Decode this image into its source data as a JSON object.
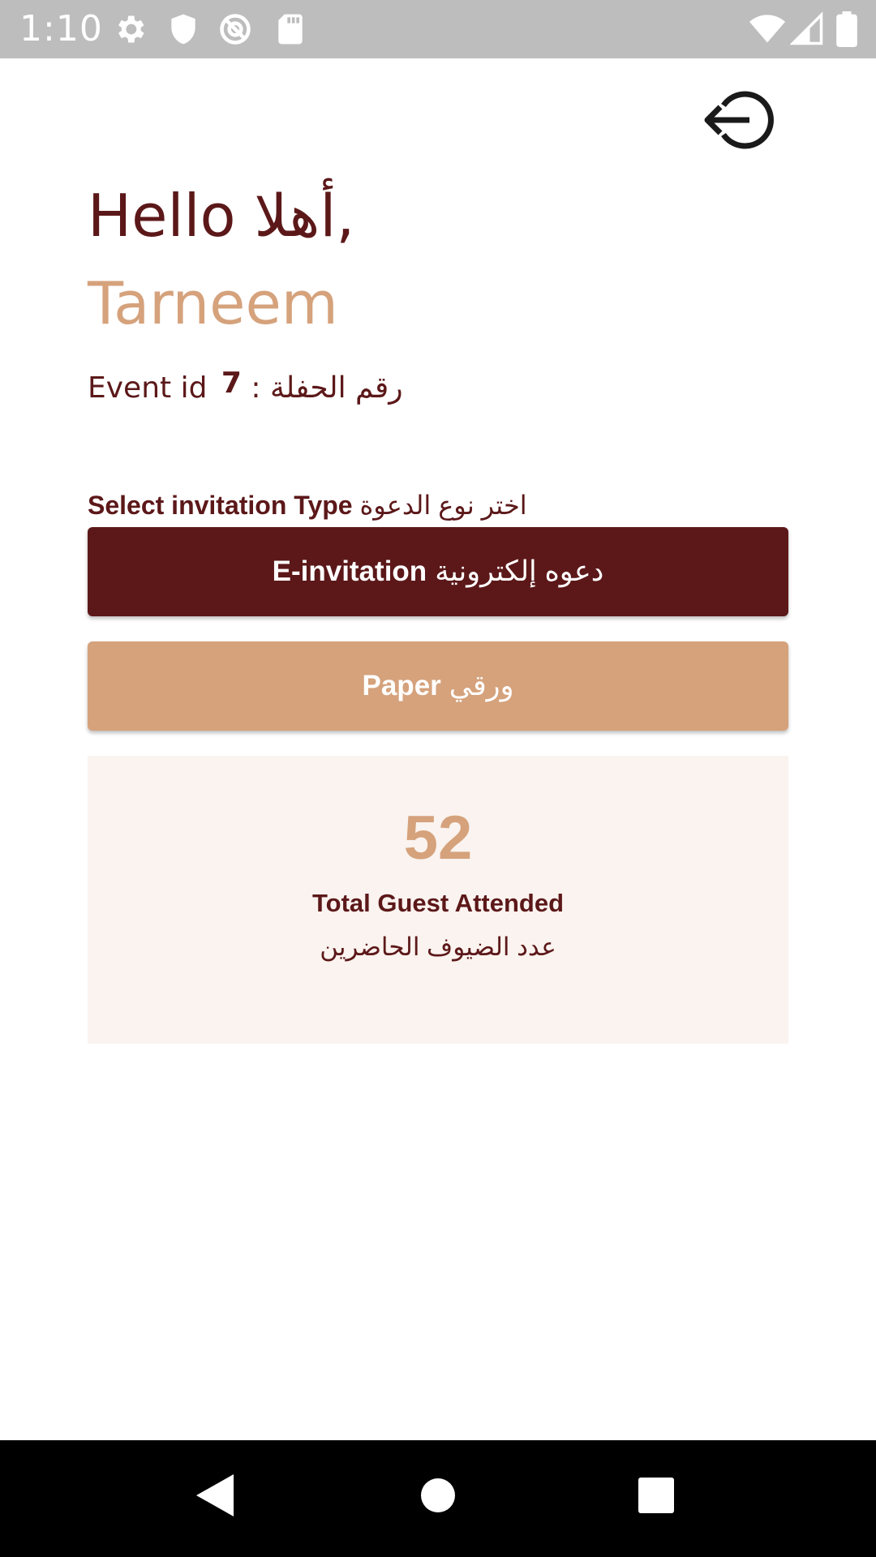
{
  "status_bar": {
    "time": "1:10",
    "left_icons": [
      "settings-icon",
      "shield-icon",
      "dnd-icon",
      "sd-card-icon"
    ],
    "right_icons": [
      "wifi-icon",
      "signal-icon",
      "battery-icon"
    ]
  },
  "header": {
    "logout_icon": "logout-icon"
  },
  "greeting": {
    "hello": "Hello أهلا,",
    "name": "Tarneem"
  },
  "event": {
    "label": "Event id رقم الحفلة :",
    "value": "7"
  },
  "invitation": {
    "select_label_en": "Select invitation Type",
    "select_label_ar": "اختر نوع الدعوة",
    "e_invitation_en": "E-invitation",
    "e_invitation_ar": "دعوه إلكترونية",
    "paper_en": "Paper",
    "paper_ar": "ورقي"
  },
  "stats": {
    "count": "52",
    "label_en": "Total Guest Attended",
    "label_ar": "عدد الضيوف الحاضرين"
  },
  "nav_bar": {
    "icons": [
      "back-icon",
      "home-icon",
      "recents-icon"
    ]
  },
  "colors": {
    "primary": "#5c1819",
    "accent": "#d5a27c",
    "card_bg": "#faf3ef",
    "status_bar": "#bdbdbd"
  }
}
